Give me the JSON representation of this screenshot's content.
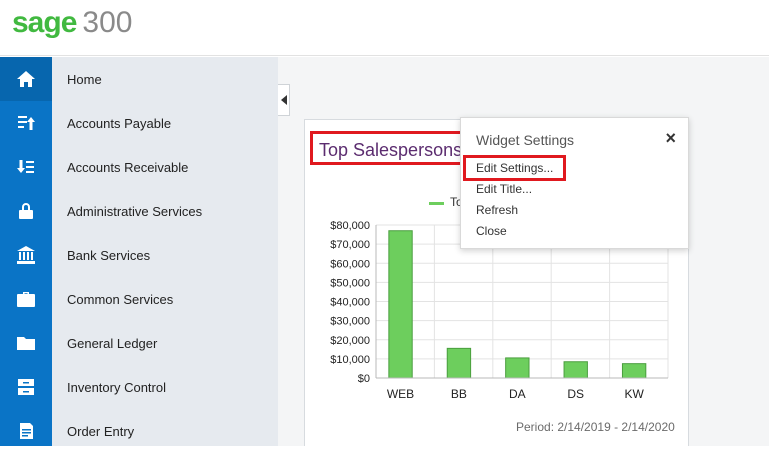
{
  "app": {
    "brand": "sage",
    "version": "300"
  },
  "nav": {
    "items": [
      {
        "label": "Home",
        "icon": "home-icon"
      },
      {
        "label": "Accounts Payable",
        "icon": "payable-icon"
      },
      {
        "label": "Accounts Receivable",
        "icon": "receivable-icon"
      },
      {
        "label": "Administrative Services",
        "icon": "lock-icon"
      },
      {
        "label": "Bank Services",
        "icon": "bank-icon"
      },
      {
        "label": "Common Services",
        "icon": "briefcase-icon"
      },
      {
        "label": "General Ledger",
        "icon": "folder-icon"
      },
      {
        "label": "Inventory Control",
        "icon": "inventory-icon"
      },
      {
        "label": "Order Entry",
        "icon": "order-icon"
      }
    ]
  },
  "widget": {
    "title": "Top Salespersons",
    "legend_label": "To",
    "period": "Period: 2/14/2019 - 2/14/2020"
  },
  "popup": {
    "title": "Widget Settings",
    "close": "×",
    "items": [
      "Edit Settings...",
      "Edit Title...",
      "Refresh",
      "Close"
    ]
  },
  "colors": {
    "accent": "#0a74c6",
    "brand": "#41b940",
    "bar": "#6dce5d",
    "highlight": "#e0191f"
  },
  "chart_data": {
    "type": "bar",
    "categories": [
      "WEB",
      "BB",
      "DA",
      "DS",
      "KW"
    ],
    "values": [
      77000,
      15500,
      10500,
      8500,
      7500
    ],
    "ylim": [
      0,
      80000
    ],
    "yticks": [
      "$0",
      "$10,000",
      "$20,000",
      "$30,000",
      "$40,000",
      "$50,000",
      "$60,000",
      "$70,000",
      "$80,000"
    ],
    "grid": true
  }
}
